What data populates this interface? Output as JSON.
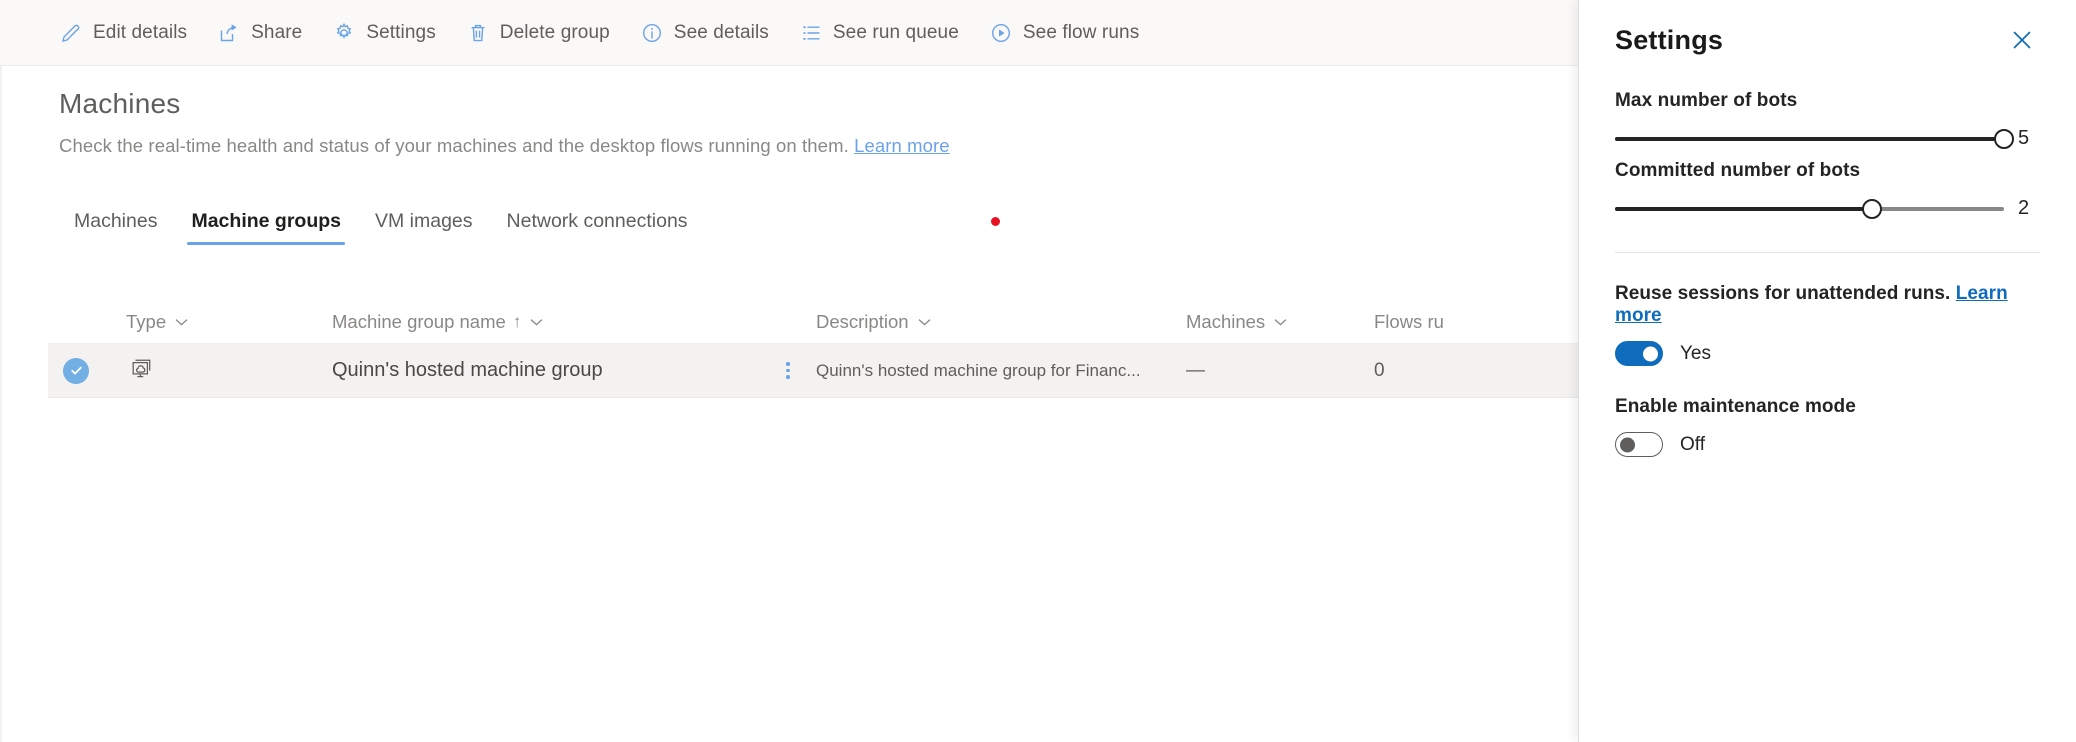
{
  "commandbar": {
    "items": [
      {
        "label": "Edit details",
        "icon": "pencil-icon"
      },
      {
        "label": "Share",
        "icon": "share-icon"
      },
      {
        "label": "Settings",
        "icon": "gear-icon"
      },
      {
        "label": "Delete group",
        "icon": "trash-icon"
      },
      {
        "label": "See details",
        "icon": "info-icon"
      },
      {
        "label": "See run queue",
        "icon": "list-icon"
      },
      {
        "label": "See flow runs",
        "icon": "play-circle-icon"
      }
    ]
  },
  "page": {
    "title": "Machines",
    "subtitle": "Check the real-time health and status of your machines and the desktop flows running on them.",
    "learn_more": "Learn more"
  },
  "tabs": [
    {
      "label": "Machines",
      "active": false
    },
    {
      "label": "Machine groups",
      "active": true
    },
    {
      "label": "VM images",
      "active": false
    },
    {
      "label": "Network connections",
      "active": false
    }
  ],
  "table": {
    "columns": {
      "type": "Type",
      "name": "Machine group name",
      "name_sort": "↑",
      "description": "Description",
      "machines": "Machines",
      "flows": "Flows ru"
    },
    "rows": [
      {
        "selected": true,
        "type_icon": "machine-group-cloud-icon",
        "name": "Quinn's hosted machine group",
        "description": "Quinn's hosted machine group for Financ...",
        "machines": "—",
        "flows": "0"
      }
    ]
  },
  "panel": {
    "title": "Settings",
    "close_icon": "close-icon",
    "max_bots": {
      "label": "Max number of bots",
      "value": "5",
      "percent": 100
    },
    "committed_bots": {
      "label": "Committed number of bots",
      "value": "2",
      "percent": 66
    },
    "reuse_sessions": {
      "label": "Reuse sessions for unattended runs.",
      "link": "Learn more",
      "state": "Yes",
      "on": true
    },
    "maintenance_mode": {
      "label": "Enable maintenance mode",
      "state": "Off",
      "on": false
    }
  },
  "colors": {
    "accent_blue": "#0f6cbd",
    "icon_blue": "#6ba3e8",
    "cursor_red": "#e81123",
    "text_gray": "#605e5c"
  }
}
